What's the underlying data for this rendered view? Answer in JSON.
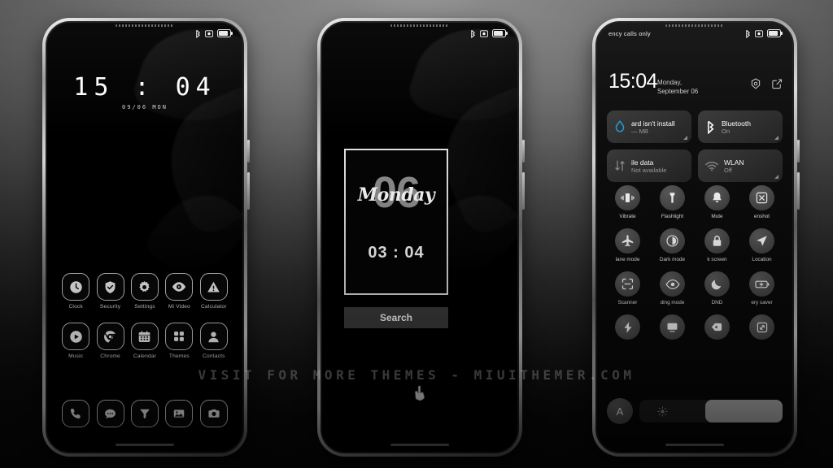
{
  "watermark": "VISIT FOR MORE THEMES - MIUITHEMER.COM",
  "status_bar": {
    "icons": [
      "bluetooth-icon",
      "dnd-icon",
      "battery-icon"
    ]
  },
  "phone1": {
    "name": "lock-screen-home",
    "lock": {
      "time": "15 : 04",
      "date": "09/06 MON"
    },
    "apps": [
      {
        "label": "Clock",
        "icon": "clock-icon"
      },
      {
        "label": "Security",
        "icon": "shield-check-icon"
      },
      {
        "label": "Settings",
        "icon": "gear-icon"
      },
      {
        "label": "Mi Video",
        "icon": "eye-play-icon"
      },
      {
        "label": "Calculator",
        "icon": "warning-triangle-icon"
      },
      {
        "label": "Music",
        "icon": "play-circle-icon"
      },
      {
        "label": "Chrome",
        "icon": "chrome-icon"
      },
      {
        "label": "Calendar",
        "icon": "calendar-icon"
      },
      {
        "label": "Themes",
        "icon": "grid-squares-icon"
      },
      {
        "label": "Contacts",
        "icon": "person-icon"
      }
    ],
    "dock": [
      {
        "label": "Phone",
        "icon": "phone-handset-icon"
      },
      {
        "label": "Messages",
        "icon": "chat-bubble-icon"
      },
      {
        "label": "Browser",
        "icon": "funnel-icon"
      },
      {
        "label": "Gallery",
        "icon": "photo-icon"
      },
      {
        "label": "Camera",
        "icon": "camera-icon"
      }
    ]
  },
  "phone2": {
    "name": "home-screen-widget",
    "widget": {
      "day_number": "06",
      "day_name": "Monday",
      "clock": "03 : 04"
    },
    "search_label": "Search",
    "cursor": "pointing-hand-cursor"
  },
  "phone3": {
    "name": "notification-shade",
    "carrier": "ency calls only",
    "time": "15:04",
    "date": "Monday, September 06",
    "header_actions": [
      {
        "name": "settings-icon"
      },
      {
        "name": "edit-icon"
      }
    ],
    "tiles": [
      {
        "title": "ard isn't install",
        "sub": "— MB",
        "icon": "storage-drop-icon",
        "accent": "#1f9fe0"
      },
      {
        "title": "Bluetooth",
        "sub": "On",
        "icon": "bluetooth-icon",
        "accent": "#ffffff"
      },
      {
        "title": "ile data",
        "sub": "Not available",
        "icon": "data-arrows-icon",
        "accent": "#8b8b8b"
      },
      {
        "title": "WLAN",
        "sub": "Off",
        "icon": "wifi-icon",
        "accent": "#8b8b8b"
      }
    ],
    "toggles": [
      {
        "label": "Vibrate",
        "icon": "vibrate-icon"
      },
      {
        "label": "Flashlight",
        "icon": "flashlight-icon"
      },
      {
        "label": "Mute",
        "icon": "bell-icon"
      },
      {
        "label": "enshot",
        "icon": "screenshot-icon"
      },
      {
        "label": "lane mode",
        "icon": "airplane-icon"
      },
      {
        "label": "Dark mode",
        "icon": "contrast-icon"
      },
      {
        "label": "k screen",
        "icon": "lock-icon"
      },
      {
        "label": "Location",
        "icon": "location-arrow-icon"
      },
      {
        "label": "Scanner",
        "icon": "scanner-frame-icon"
      },
      {
        "label": "ding mode",
        "icon": "eye-icon"
      },
      {
        "label": "DND",
        "icon": "moon-icon"
      },
      {
        "label": "ery saver",
        "icon": "battery-plus-icon"
      },
      {
        "label": "",
        "icon": "lightning-icon"
      },
      {
        "label": "",
        "icon": "cast-screen-icon"
      },
      {
        "label": "",
        "icon": "tag-icon"
      },
      {
        "label": "",
        "icon": "rotate-screen-icon"
      }
    ],
    "brightness": {
      "auto_label": "A",
      "sun_icon": "sun-icon",
      "level_percent": 54
    }
  }
}
